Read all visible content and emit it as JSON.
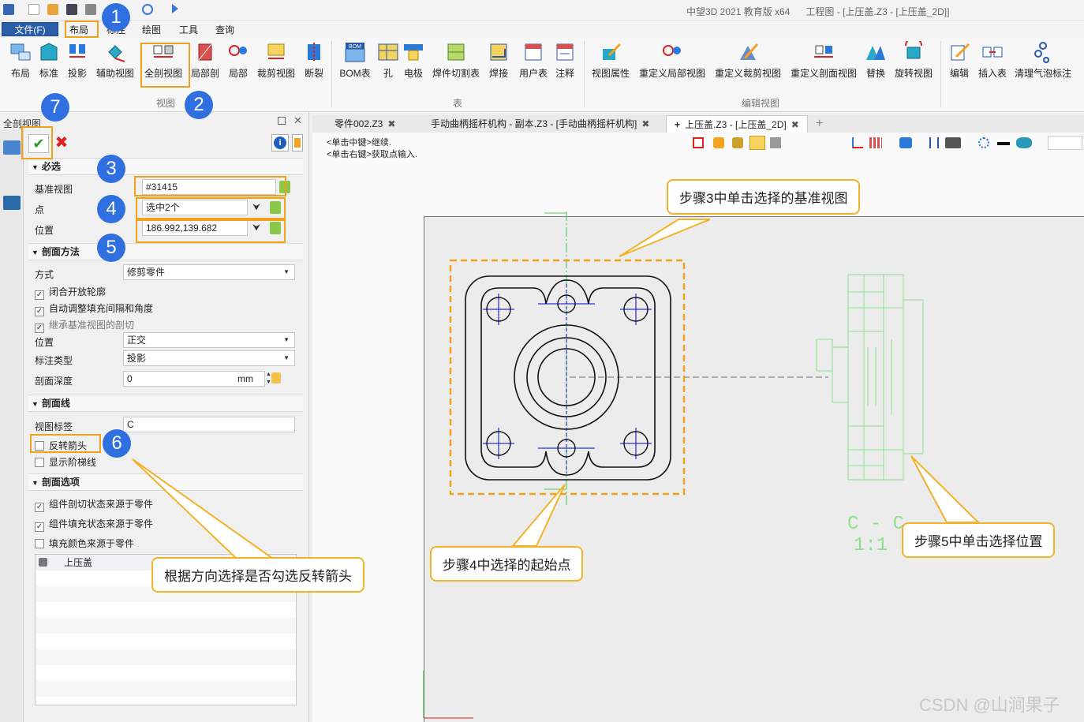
{
  "app": {
    "title": "中望3D 2021 教育版 x64",
    "doc_title": "工程图 - [上压盖.Z3 - [上压盖_2D]]"
  },
  "menu": {
    "file": "文件(F)",
    "items": [
      "布局",
      "标注",
      "绘图",
      "工具",
      "查询"
    ]
  },
  "ribbon": {
    "layout_tools": [
      "布局",
      "标准",
      "投影",
      "辅助视图",
      "全剖视图",
      "局部剖",
      "局部",
      "裁剪视图",
      "断裂"
    ],
    "group_view": "视图",
    "table_tools": [
      "BOM表",
      "孔",
      "电极",
      "焊件切割表",
      "焊接",
      "用户表",
      "注释"
    ],
    "group_table": "表",
    "edit_tools": [
      "视图属性",
      "重定义局部视图",
      "重定义裁剪视图",
      "重定义剖面视图",
      "替换",
      "旋转视图"
    ],
    "group_edit": "编辑视图",
    "misc_tools": [
      "编辑",
      "插入表",
      "清理气泡标注"
    ],
    "bom_badge": "BOM"
  },
  "panel": {
    "title": "全剖视图",
    "required": {
      "header": "必选",
      "base_view_label": "基准视图",
      "base_view_value": "#31415",
      "point_label": "点",
      "point_value": "选中2个",
      "position_label": "位置",
      "position_value": "186.992,139.682"
    },
    "method": {
      "header": "剖面方法",
      "mode_label": "方式",
      "mode_value": "修剪零件",
      "check_close": "闭合开放轮廓",
      "check_auto": "自动调整填充间隔和角度",
      "check_inherit": "继承基准视图的剖切",
      "pos_label": "位置",
      "pos_value": "正交",
      "anno_label": "标注类型",
      "anno_value": "投影",
      "depth_label": "剖面深度",
      "depth_value": "0",
      "depth_unit": "mm"
    },
    "line": {
      "header": "剖面线",
      "label_label": "视图标签",
      "label_value": "C",
      "check_reverse": "反转箭头",
      "check_step": "显示阶梯线"
    },
    "options": {
      "header": "剖面选项",
      "check_comp_cut": "组件剖切状态来源于零件",
      "check_comp_fill": "组件填充状态来源于零件",
      "check_fill_color": "填充颜色来源于零件",
      "part_name": "上压盖"
    }
  },
  "tabs": [
    "零件002.Z3",
    "手动曲柄摇杆机构 - 副本.Z3 - [手动曲柄摇杆机构]",
    "上压盖.Z3 - [上压盖_2D]"
  ],
  "prompt": {
    "line1": "<单击中键>继续.",
    "line2": "<单击右键>获取点输入."
  },
  "drawing": {
    "section_label": "C - C",
    "scale_label": "1:1"
  },
  "callouts": {
    "step3": "步骤3中单击选择的基准视图",
    "step4": "步骤4中选择的起始点",
    "step5": "步骤5中单击选择位置",
    "step6": "根据方向选择是否勾选反转箭头"
  },
  "steps": [
    "1",
    "2",
    "3",
    "4",
    "5",
    "6",
    "7"
  ],
  "watermark": "CSDN @山涧果子",
  "colors": {
    "accent_orange": "#f2a21a",
    "step_blue": "#2f6fe0",
    "drawing_black": "#111111",
    "center_blue": "#0000cc",
    "projection_green": "#8fe08f"
  }
}
